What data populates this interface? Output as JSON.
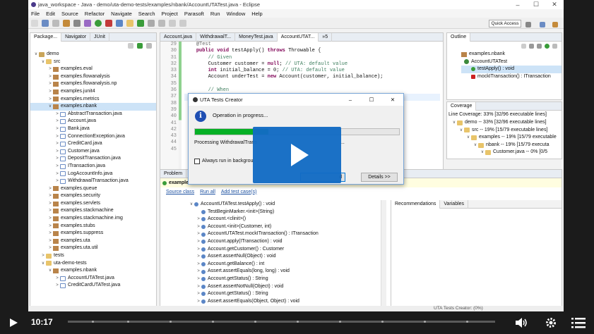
{
  "window": {
    "title": "java_workspace - Java - demo/uta-demo-tests/examples/nbank/AccountUTATest.java - Eclipse",
    "min": "–",
    "max": "☐",
    "close": "✕"
  },
  "menu": [
    "File",
    "Edit",
    "Source",
    "Refactor",
    "Navigate",
    "Search",
    "Project",
    "Parasoft",
    "Run",
    "Window",
    "Help"
  ],
  "quick_access": "Quick Access",
  "package_explorer": {
    "tabs": [
      "Package...",
      "Navigator",
      "JUnit"
    ],
    "items": [
      {
        "label": "demo",
        "depth": 0,
        "icon": "project-icon",
        "arrow": "∨"
      },
      {
        "label": "src",
        "depth": 1,
        "icon": "source-folder-icon",
        "arrow": "∨"
      },
      {
        "label": "examples.eval",
        "depth": 2,
        "icon": "package-icon",
        "arrow": ">"
      },
      {
        "label": "examples.flowanalysis",
        "depth": 2,
        "icon": "package-icon",
        "arrow": ">"
      },
      {
        "label": "examples.flowanalysis.np",
        "depth": 2,
        "icon": "package-icon",
        "arrow": ">"
      },
      {
        "label": "examples.junit4",
        "depth": 2,
        "icon": "package-icon",
        "arrow": ">"
      },
      {
        "label": "examples.metrics",
        "depth": 2,
        "icon": "package-icon",
        "arrow": ">"
      },
      {
        "label": "examples.nbank",
        "depth": 2,
        "icon": "package-icon",
        "arrow": "∨",
        "selected": true
      },
      {
        "label": "AbstractTransaction.java",
        "depth": 3,
        "icon": "java-file-icon",
        "arrow": ">"
      },
      {
        "label": "Account.java",
        "depth": 3,
        "icon": "java-file-icon",
        "arrow": ">"
      },
      {
        "label": "Bank.java",
        "depth": 3,
        "icon": "java-file-icon",
        "arrow": ">"
      },
      {
        "label": "ConnectionException.java",
        "depth": 3,
        "icon": "java-file-icon",
        "arrow": ">"
      },
      {
        "label": "CreditCard.java",
        "depth": 3,
        "icon": "java-file-icon",
        "arrow": ">"
      },
      {
        "label": "Customer.java",
        "depth": 3,
        "icon": "java-file-icon",
        "arrow": ">"
      },
      {
        "label": "DepositTransaction.java",
        "depth": 3,
        "icon": "java-file-icon",
        "arrow": ">"
      },
      {
        "label": "ITransaction.java",
        "depth": 3,
        "icon": "java-file-icon",
        "arrow": ">"
      },
      {
        "label": "LogAccountInfo.java",
        "depth": 3,
        "icon": "java-file-icon",
        "arrow": ">"
      },
      {
        "label": "WithdrawalTransaction.java",
        "depth": 3,
        "icon": "java-file-icon",
        "arrow": ">"
      },
      {
        "label": "examples.queue",
        "depth": 2,
        "icon": "package-icon",
        "arrow": ">"
      },
      {
        "label": "examples.security",
        "depth": 2,
        "icon": "package-icon",
        "arrow": ">"
      },
      {
        "label": "examples.servlets",
        "depth": 2,
        "icon": "package-icon",
        "arrow": ">"
      },
      {
        "label": "examples.stackmachine",
        "depth": 2,
        "icon": "package-icon",
        "arrow": ">"
      },
      {
        "label": "examples.stackmachine.img",
        "depth": 2,
        "icon": "package-icon",
        "arrow": ">"
      },
      {
        "label": "examples.stubs",
        "depth": 2,
        "icon": "package-icon",
        "arrow": ">"
      },
      {
        "label": "examples.suppress",
        "depth": 2,
        "icon": "package-icon",
        "arrow": ">"
      },
      {
        "label": "examples.uta",
        "depth": 2,
        "icon": "package-icon",
        "arrow": ">"
      },
      {
        "label": "examples.uta.util",
        "depth": 2,
        "icon": "package-icon",
        "arrow": ">"
      },
      {
        "label": "tests",
        "depth": 1,
        "icon": "source-folder-icon",
        "arrow": ">"
      },
      {
        "label": "uta-demo-tests",
        "depth": 1,
        "icon": "source-folder-icon",
        "arrow": "∨"
      },
      {
        "label": "examples.nbank",
        "depth": 2,
        "icon": "package-icon",
        "arrow": "∨"
      },
      {
        "label": "AccountUTATest.java",
        "depth": 3,
        "icon": "java-file-icon",
        "arrow": ">"
      },
      {
        "label": "CreditCardUTATest.java",
        "depth": 3,
        "icon": "java-file-icon",
        "arrow": ">"
      }
    ]
  },
  "editor": {
    "tabs": [
      "Account.java",
      "WithdrawalT...",
      "MoneyTest.java",
      "AccountUTAT...",
      "»5"
    ],
    "line_numbers": [
      "29",
      "30",
      "31",
      "32",
      "33",
      "34",
      "35",
      "36",
      "37",
      "38",
      "39",
      "40",
      "41",
      "42",
      "43",
      "44",
      "45"
    ],
    "code": [
      "    @Test",
      "    public void testApply() throws Throwable {",
      "        // Given",
      "        Customer customer = null; // UTA: default value",
      "        int initial_balance = 0; // UTA: default value",
      "        Account underTest = new Account(customer, initial_balance);",
      "",
      "        // When",
      "",
      "",
      "",
      "",
      "",
      "",
      "",
      "",
      ""
    ]
  },
  "outline": {
    "tab": "Outline",
    "items": [
      {
        "label": "examples.nbank",
        "icon": "package-icon"
      },
      {
        "label": "AccountUTATest",
        "icon": "class-icon"
      },
      {
        "label": "testApply() : void",
        "icon": "public-method-icon",
        "selected": true
      },
      {
        "label": "mockITransaction() : ITransaction",
        "icon": "private-method-icon"
      }
    ]
  },
  "coverage": {
    "tab": "Coverage",
    "summary": "Line Coverage: 33% [32/96 executable lines]",
    "items": [
      {
        "label": "demo -- 33% [32/96 executable lines]"
      },
      {
        "label": "src -- 19% [15/79 executable lines]"
      },
      {
        "label": "examples -- 19% [15/79 executable"
      },
      {
        "label": "nbank -- 19% [15/79 executa"
      },
      {
        "label": "Customer.java -- 0% [0/5"
      }
    ]
  },
  "bottom": {
    "tab": "Problem",
    "header": "example",
    "links": [
      "Source class",
      "Run all",
      "Add test case(s)"
    ],
    "right_tabs": [
      "Recommendations",
      "Variables"
    ],
    "tree": [
      {
        "label": "AccountUTATest.testApply() : void",
        "arrow": "∨"
      },
      {
        "label": "TestBeginMarker.<init>(String)",
        "arrow": ""
      },
      {
        "label": "Account.<clinit>()",
        "arrow": ">"
      },
      {
        "label": "Account.<init>(Customer, int)",
        "arrow": ">"
      },
      {
        "label": "AccountUTATest.mockITransaction() : ITransaction",
        "arrow": ">"
      },
      {
        "label": "Account.apply(ITransaction) : void",
        "arrow": ">"
      },
      {
        "label": "Account.getCustomer() : Customer",
        "arrow": ">"
      },
      {
        "label": "Assert.assertNull(Object) : void",
        "arrow": ">"
      },
      {
        "label": "Account.getBalance() : int",
        "arrow": ">"
      },
      {
        "label": "Assert.assertEquals(long, long) : void",
        "arrow": ">"
      },
      {
        "label": "Account.getStatus() : String",
        "arrow": ">"
      },
      {
        "label": "Assert.assertNotNull(Object) : void",
        "arrow": ">"
      },
      {
        "label": "Account.getStatus() : String",
        "arrow": ">"
      },
      {
        "label": "Assert.assertEquals(Object, Object) : void",
        "arrow": ">"
      }
    ]
  },
  "dialog": {
    "title": "UTA Tests Creator",
    "message": "Operation in progress...",
    "progress": 0.36,
    "processing": "Processing WithdrawalTrans",
    "processing_tail": "...",
    "checkbox": "Always run in backgrou",
    "run_bg_label": "d",
    "details": "Details >>"
  },
  "status": {
    "left": "",
    "right": "UTA Tests Creator: (0%)"
  },
  "player": {
    "time": "10:17",
    "progress": 0.0
  },
  "colors": {
    "accent": "#126bc4",
    "progress_green": "#06b025"
  }
}
